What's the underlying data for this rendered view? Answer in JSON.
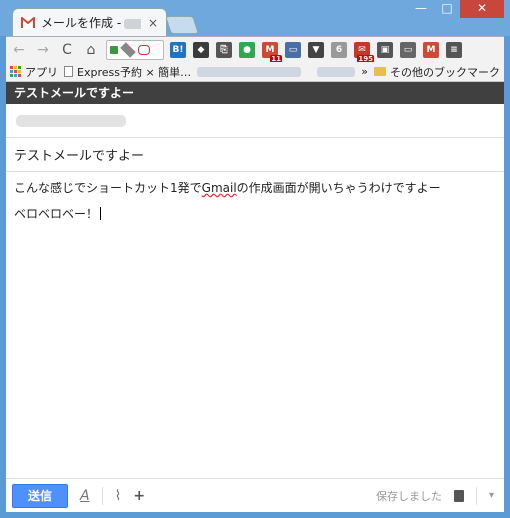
{
  "browser": {
    "tab_title": "メールを作成 -",
    "tab_close": "×",
    "window_buttons": {
      "minimize": "—",
      "maximize": "□",
      "close": "✕"
    },
    "nav": {
      "back": "←",
      "forward": "→",
      "reload": "C",
      "home": "⌂"
    },
    "extensions": [
      {
        "name": "hatena-bookmark-icon",
        "label": "B!",
        "color": "#1e74c3"
      },
      {
        "name": "evernote-icon",
        "label": "◆",
        "color": "#3b3b3b"
      },
      {
        "name": "copy-icon",
        "label": "⎘",
        "color": "#555555"
      },
      {
        "name": "green-dot-icon",
        "label": "●",
        "color": "#2fa84f"
      },
      {
        "name": "gmail-notifier-icon",
        "label": "M",
        "color": "#d14836",
        "badge": "11"
      },
      {
        "name": "window-icon",
        "label": "▭",
        "color": "#4a6fa5"
      },
      {
        "name": "pocket-icon",
        "label": "▼",
        "color": "#444444"
      },
      {
        "name": "counter-icon",
        "label": "6",
        "color": "#999999"
      },
      {
        "name": "mail-count-icon",
        "label": "✉",
        "color": "#c0392b",
        "badge": "195"
      },
      {
        "name": "reader-icon",
        "label": "▣",
        "color": "#555555"
      },
      {
        "name": "cast-icon",
        "label": "▭",
        "color": "#666666"
      },
      {
        "name": "gmail-icon",
        "label": "M",
        "color": "#d14836"
      },
      {
        "name": "menu-icon",
        "label": "≡",
        "color": "#555555"
      }
    ]
  },
  "bookmarks": {
    "apps": "アプリ",
    "express": "Express予約 × 簡単…",
    "overflow": "»",
    "other": "その他のブックマーク"
  },
  "compose": {
    "header_title": "テストメールですよー",
    "subject": "テストメールですよー",
    "body_line1_pre": "こんな感じでショートカット1発で",
    "body_line1_spell": "Gmail",
    "body_line1_post": "の作成画面が開いちゃうわけですよー",
    "body_line2": "ベロベロベー！",
    "send_label": "送信",
    "saved_label": "保存しました",
    "format_icon": "A",
    "attach_icon": "⌇",
    "plus_icon": "+",
    "more_icon": "▾"
  }
}
